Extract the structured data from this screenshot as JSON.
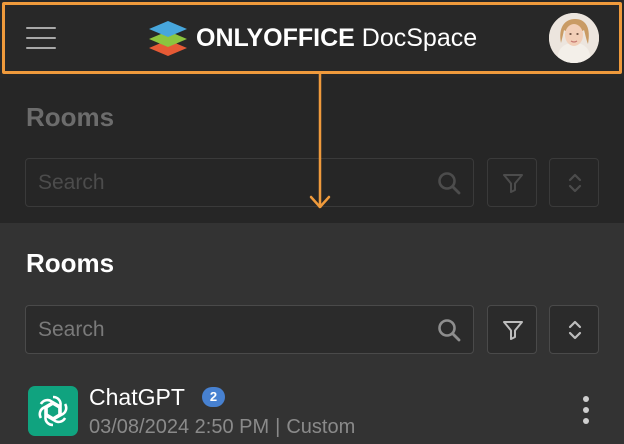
{
  "colors": {
    "accent_highlight": "#ef9a3c",
    "header_bg": "#282828",
    "panel_bg": "#333333",
    "badge_bg": "#4781d1",
    "room_icon_bg": "#10a37f"
  },
  "header": {
    "menu_icon": "hamburger-menu-icon",
    "logo": {
      "brand": "ONLYOFFICE",
      "product": "DocSpace"
    },
    "avatar_icon": "user-avatar"
  },
  "preview": {
    "title": "Rooms",
    "search_placeholder": "Search"
  },
  "rooms_page": {
    "title": "Rooms",
    "search": {
      "placeholder": "Search",
      "value": ""
    },
    "filter_icon": "filter-icon",
    "sort_icon": "sort-icon"
  },
  "rooms": [
    {
      "name": "ChatGPT",
      "badge": "2",
      "date": "03/08/2024 2:50 PM",
      "separator": "|",
      "type": "Custom",
      "icon": "chatgpt-logo"
    }
  ]
}
